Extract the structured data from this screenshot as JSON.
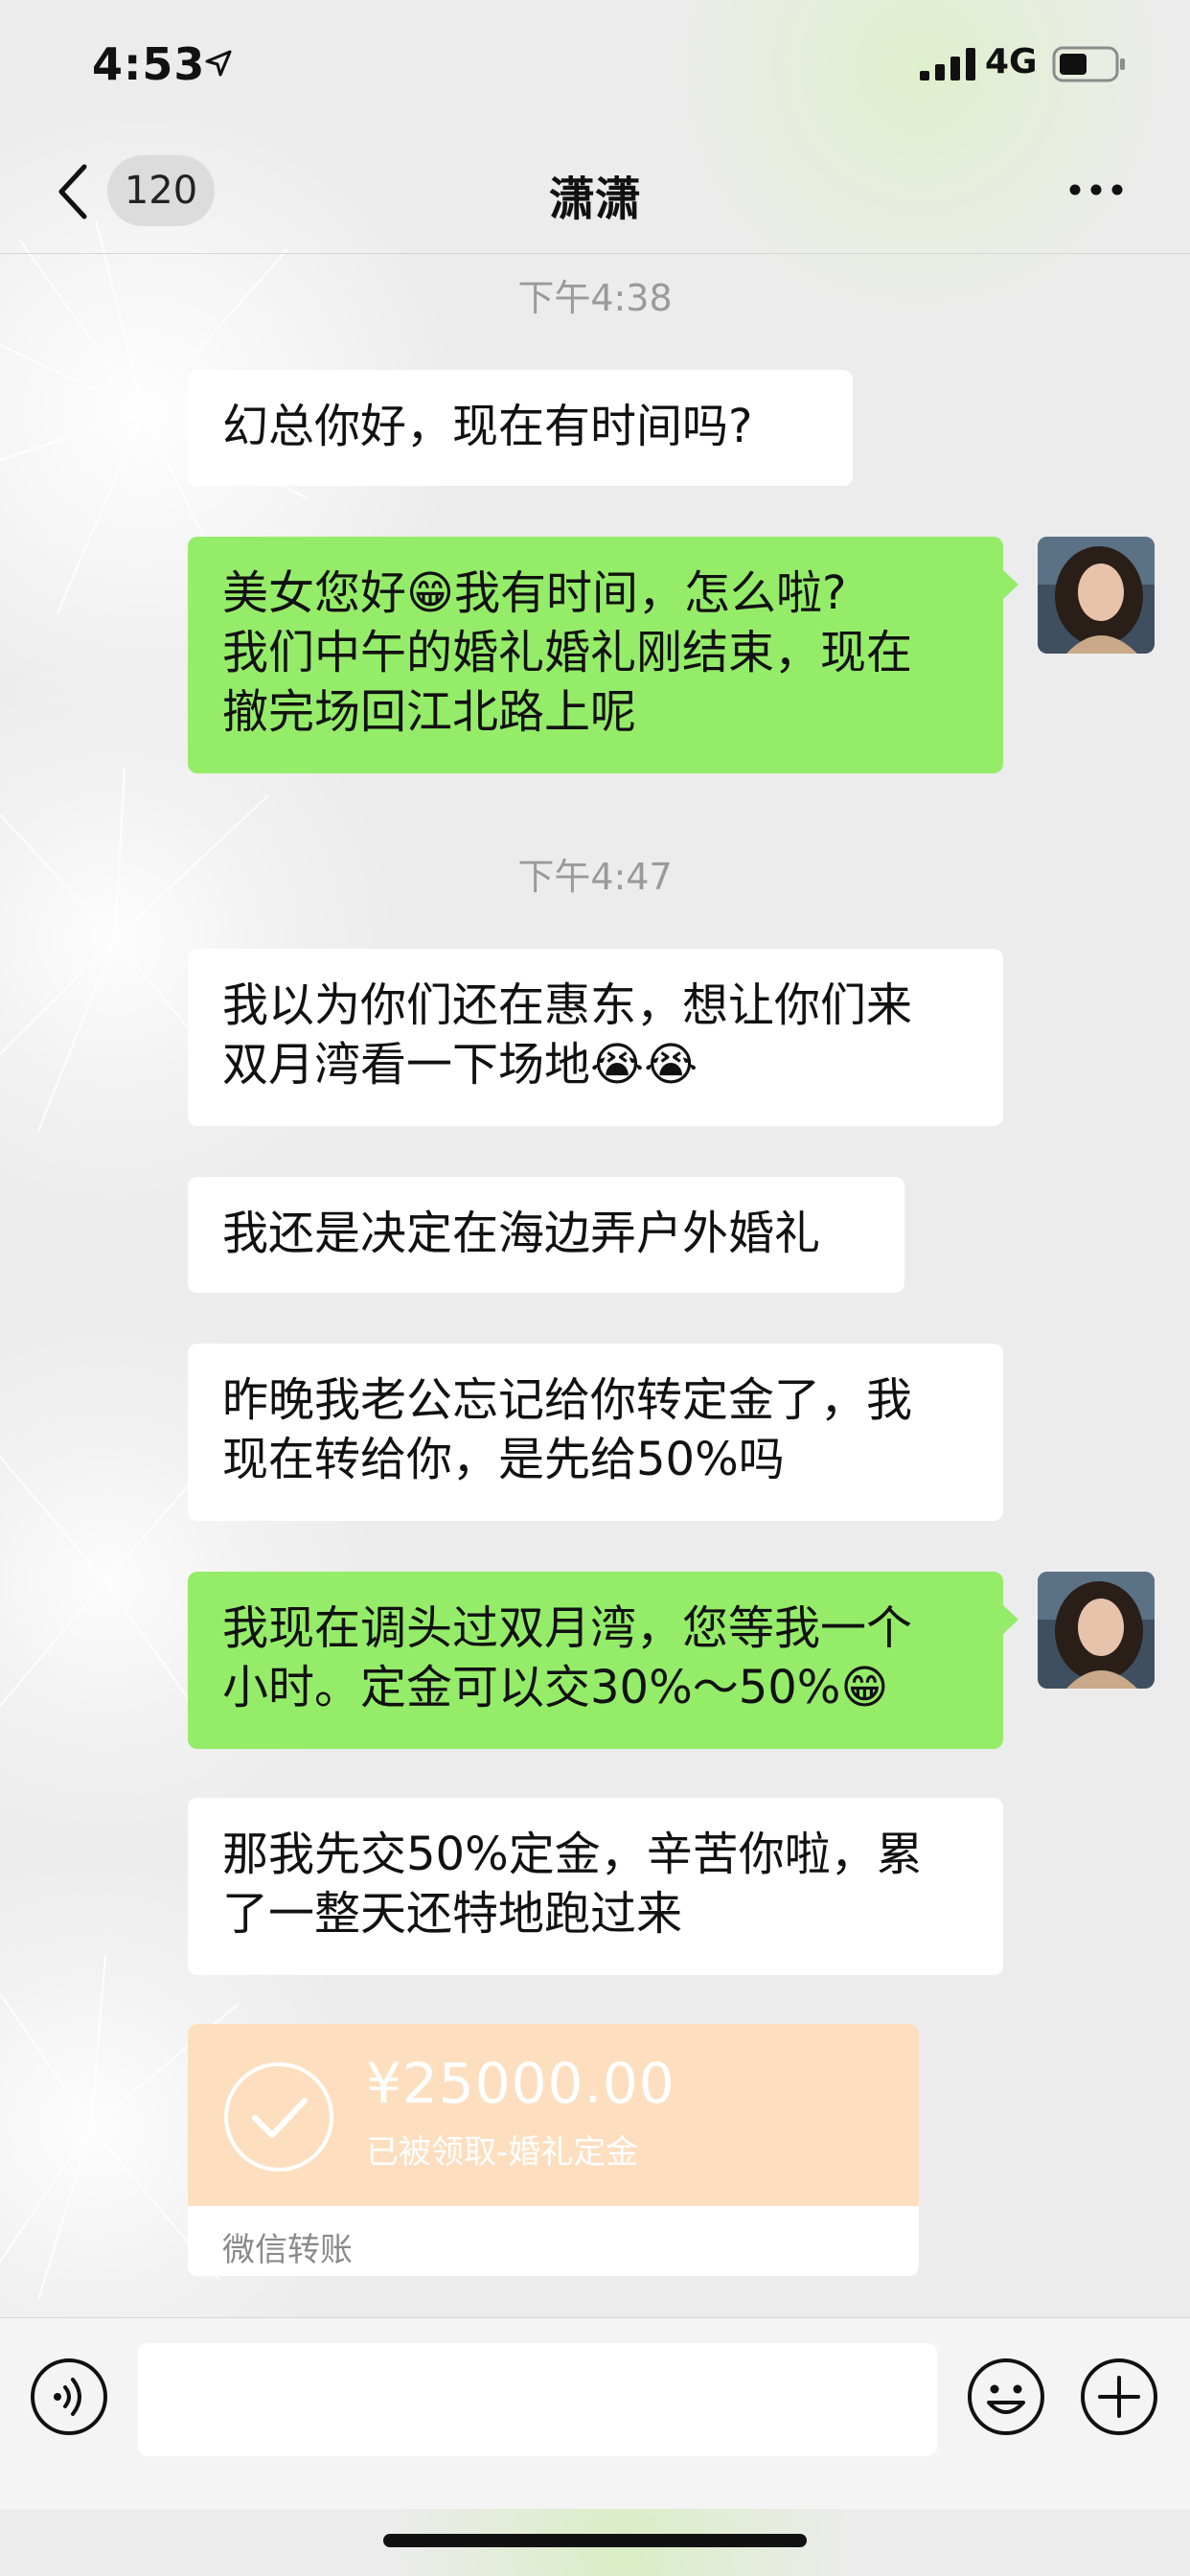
{
  "status_bar": {
    "time": "4:53",
    "location_icon": "location-arrow-icon",
    "signal_icon": "cellular-signal-icon",
    "network": "4G",
    "battery_icon": "battery-icon"
  },
  "nav": {
    "back_icon": "chevron-left-icon",
    "unread_count": "120",
    "title": "潇潇",
    "more_icon": "more-dots-icon"
  },
  "messages": [
    {
      "type": "timestamp",
      "text": "下午4:38"
    },
    {
      "type": "incoming",
      "text": "幻总你好，现在有时间吗?"
    },
    {
      "type": "outgoing",
      "text": "美女您好😁我有时间，怎么啦?\n我们中午的婚礼婚礼刚结束，现在\n撤完场回江北路上呢"
    },
    {
      "type": "timestamp",
      "text": "下午4:47"
    },
    {
      "type": "incoming",
      "text": "我以为你们还在惠东，想让你们来\n双月湾看一下场地😭😭"
    },
    {
      "type": "incoming",
      "text": "我还是决定在海边弄户外婚礼"
    },
    {
      "type": "incoming",
      "text": "昨晚我老公忘记给你转定金了，我\n现在转给你，是先给50%吗"
    },
    {
      "type": "outgoing",
      "text": "我现在调头过双月湾，您等我一个\n小时。定金可以交30%～50%😁"
    },
    {
      "type": "incoming",
      "text": "那我先交50%定金，辛苦你啦，累\n了一整天还特地跑过来"
    }
  ],
  "transfer": {
    "icon": "check-circle-icon",
    "amount": "¥25000.00",
    "note": "已被领取-婚礼定金",
    "label": "微信转账"
  },
  "input_bar": {
    "voice_icon": "voice-icon",
    "placeholder": "",
    "emoji_icon": "emoji-icon",
    "plus_icon": "plus-icon"
  },
  "colors": {
    "outgoing_bubble": "#95ec69",
    "incoming_bubble": "#ffffff",
    "transfer_card": "#fddfc0",
    "background": "#ececec"
  }
}
